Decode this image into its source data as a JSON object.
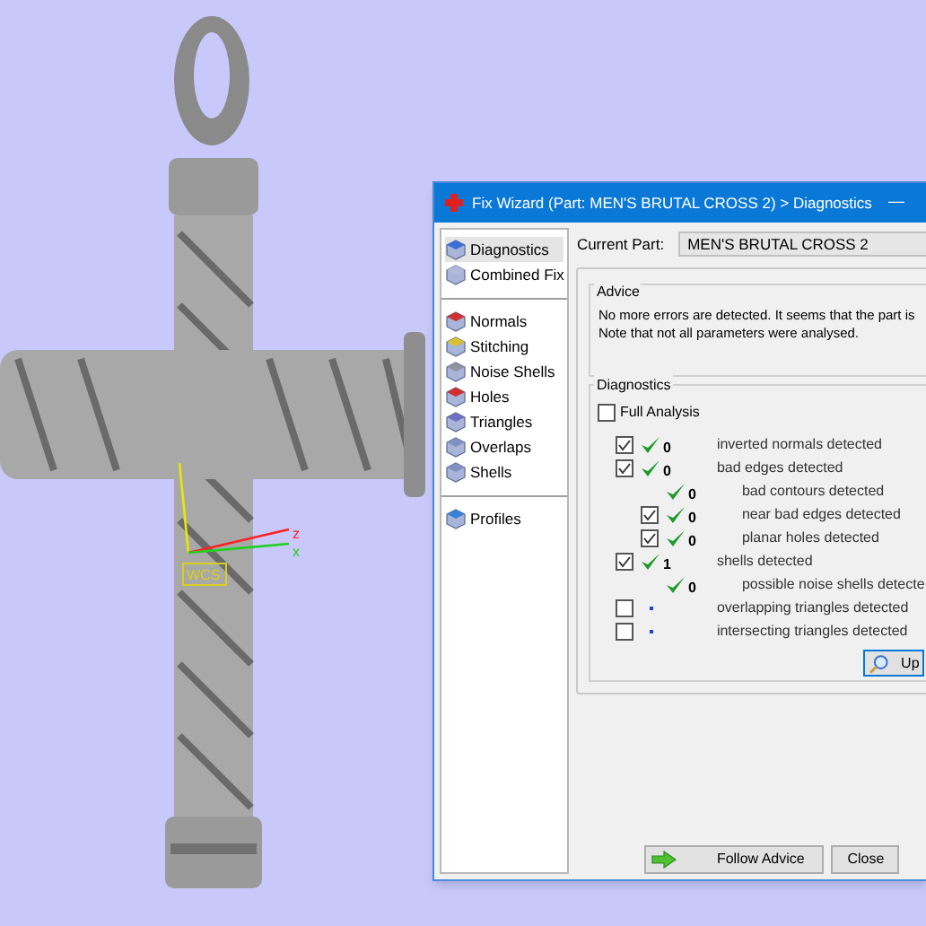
{
  "viewport": {
    "axes": {
      "z_label": "z",
      "x_label": "x",
      "frame_label": "WCS"
    }
  },
  "window": {
    "title": "Fix Wizard (Part: MEN'S BRUTAL CROSS 2) > Diagnostics",
    "minimize": "—"
  },
  "sidebar": {
    "groups": [
      [
        {
          "label": "Diagnostics",
          "selected": true
        },
        {
          "label": "Combined Fix",
          "selected": false
        }
      ],
      [
        {
          "label": "Normals",
          "selected": false
        },
        {
          "label": "Stitching",
          "selected": false
        },
        {
          "label": "Noise Shells",
          "selected": false
        },
        {
          "label": "Holes",
          "selected": false
        },
        {
          "label": "Triangles",
          "selected": false
        },
        {
          "label": "Overlaps",
          "selected": false
        },
        {
          "label": "Shells",
          "selected": false
        }
      ],
      [
        {
          "label": "Profiles",
          "selected": false
        }
      ]
    ]
  },
  "current_part": {
    "label": "Current Part:",
    "value": "MEN'S BRUTAL CROSS 2"
  },
  "advice": {
    "title": "Advice",
    "text": "No more errors are detected. It seems that the part is\nNote that not all parameters were analysed."
  },
  "diagnostics": {
    "title": "Diagnostics",
    "full_analysis": {
      "label": "Full Analysis",
      "checked": false
    },
    "rows": [
      {
        "kind": "checkbox",
        "checked": true,
        "passed": true,
        "count": "0",
        "label": "inverted normals detected"
      },
      {
        "kind": "checkbox",
        "checked": true,
        "passed": true,
        "count": "0",
        "label": "bad edges detected",
        "children": [
          {
            "kind": "plain",
            "passed": true,
            "count": "0",
            "label": "bad contours detected"
          },
          {
            "kind": "checkbox",
            "checked": true,
            "passed": true,
            "count": "0",
            "label": "near bad edges detected"
          },
          {
            "kind": "checkbox",
            "checked": true,
            "passed": true,
            "count": "0",
            "label": "planar holes detected"
          }
        ]
      },
      {
        "kind": "checkbox",
        "checked": true,
        "passed": true,
        "count": "1",
        "label": "shells detected",
        "children": [
          {
            "kind": "plain",
            "passed": true,
            "count": "0",
            "label": "possible noise shells detecte"
          }
        ]
      },
      {
        "kind": "checkbox",
        "checked": false,
        "passed": false,
        "label": "overlapping triangles detected"
      },
      {
        "kind": "checkbox",
        "checked": false,
        "passed": false,
        "label": "intersecting triangles detected"
      }
    ],
    "update_button": "Up"
  },
  "buttons": [
    "Follow Advice",
    "Close"
  ]
}
